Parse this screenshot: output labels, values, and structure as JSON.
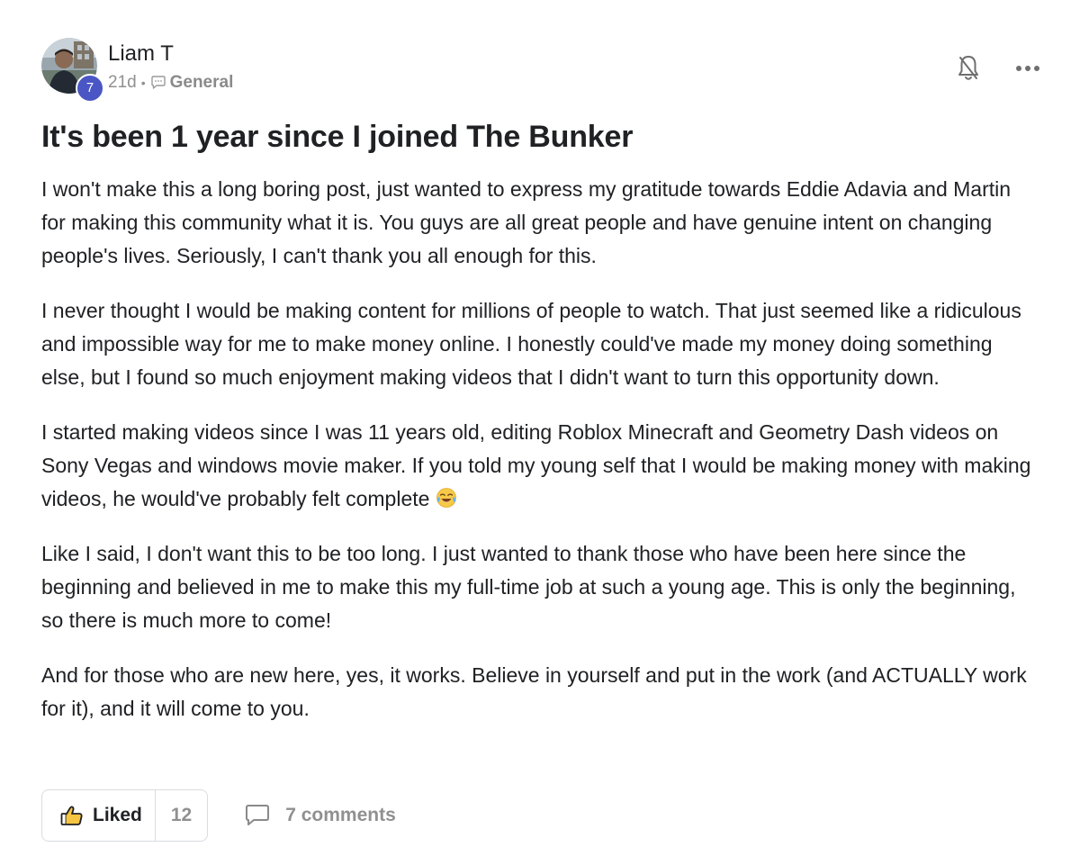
{
  "post": {
    "author": {
      "name": "Liam T",
      "level": "7",
      "avatar_icon": "user-avatar-photo"
    },
    "meta": {
      "time": "21d",
      "separator": "•",
      "category_icon": "chat-bubble-icon",
      "category": "General"
    },
    "header_actions": [
      {
        "icon": "bell-off-icon"
      },
      {
        "icon": "more-horizontal-icon"
      }
    ],
    "title": "It's been 1 year since I joined The Bunker",
    "paragraphs": [
      "I won't make this a long boring post, just wanted to express my gratitude towards Eddie Adavia and Martin for making this community what it is. You guys are all great people and have genuine intent on changing people's lives. Seriously, I can't thank you all enough for this.",
      "I never thought I would be making content for millions of people to watch. That just seemed like a ridiculous and impossible way for me to make money online. I honestly could've made my money doing something else, but I found so much enjoyment making videos that I didn't want to turn this opportunity down.",
      "I started making videos since I was 11 years old, editing Roblox Minecraft and Geometry Dash videos on Sony Vegas and windows movie maker. If you told my young self that I would be making money with making videos, he would've probably felt complete",
      "Like I said, I don't want this to be too long. I just wanted to thank those who have been here since the beginning and believed in me to make this my full-time job at such a young age. This is only the beginning, so there is much more to come!",
      "And for those who are new here, yes, it works. Believe in yourself and put in the work (and ACTUALLY work for it), and it will come to you."
    ],
    "paragraph3_emoji": "face-with-tears-of-joy-emoji",
    "actions": {
      "like_label": "Liked",
      "like_icon": "thumbs-up-icon",
      "like_count": "12",
      "comments_icon": "comment-icon",
      "comments_label": "7 comments"
    }
  },
  "colors": {
    "badge": "#4a56c4",
    "text": "#202124",
    "muted": "#909090",
    "border": "#dadce0"
  }
}
